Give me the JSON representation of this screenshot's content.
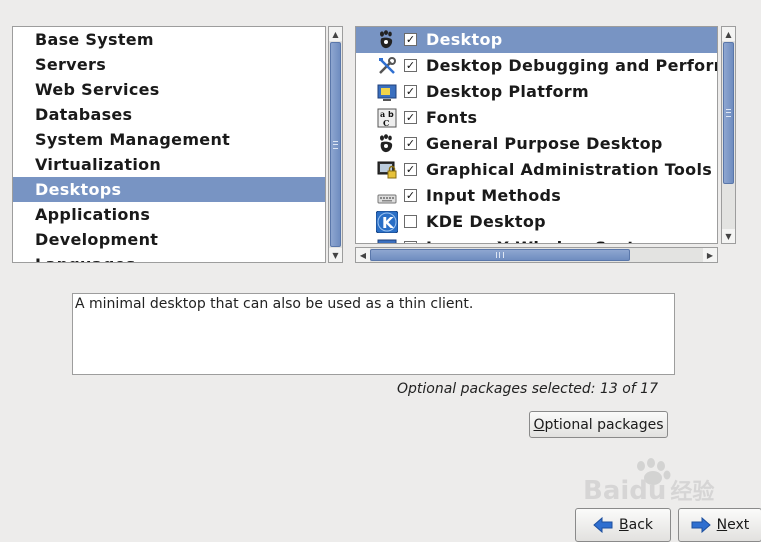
{
  "categories": [
    {
      "label": "Base System",
      "selected": false
    },
    {
      "label": "Servers",
      "selected": false
    },
    {
      "label": "Web Services",
      "selected": false
    },
    {
      "label": "Databases",
      "selected": false
    },
    {
      "label": "System Management",
      "selected": false
    },
    {
      "label": "Virtualization",
      "selected": false
    },
    {
      "label": "Desktops",
      "selected": true
    },
    {
      "label": "Applications",
      "selected": false
    },
    {
      "label": "Development",
      "selected": false
    },
    {
      "label": "Languages",
      "selected": false
    }
  ],
  "packages": [
    {
      "label": "Desktop",
      "checked": true,
      "selected": true,
      "icon": "gnome-foot-icon"
    },
    {
      "label": "Desktop Debugging and Perform",
      "checked": true,
      "selected": false,
      "icon": "tools-icon"
    },
    {
      "label": "Desktop Platform",
      "checked": true,
      "selected": false,
      "icon": "desktop-platform-icon"
    },
    {
      "label": "Fonts",
      "checked": true,
      "selected": false,
      "icon": "fonts-icon"
    },
    {
      "label": "General Purpose Desktop",
      "checked": true,
      "selected": false,
      "icon": "gnome-foot-icon"
    },
    {
      "label": "Graphical Administration Tools",
      "checked": true,
      "selected": false,
      "icon": "monitor-lock-icon"
    },
    {
      "label": "Input Methods",
      "checked": true,
      "selected": false,
      "icon": "keyboard-icon"
    },
    {
      "label": "KDE Desktop",
      "checked": false,
      "selected": false,
      "icon": "kde-icon"
    },
    {
      "label": "Legacy X Window System",
      "checked": false,
      "selected": false,
      "icon": "monitor-icon"
    }
  ],
  "description": "A minimal desktop that can also be used as a thin client.",
  "optional_status": "Optional packages selected: 13 of 17",
  "buttons": {
    "optional_packages": {
      "mnemonic": "O",
      "rest": "ptional packages"
    },
    "back": {
      "mnemonic": "B",
      "rest": "ack"
    },
    "next": {
      "mnemonic": "N",
      "rest": "ext"
    }
  },
  "watermark": {
    "brand": "Baidu",
    "suffix": "经验"
  },
  "colors": {
    "selection": "#7894c3",
    "accent_blue": "#2f6fd0",
    "panel_border": "#9d9d9d"
  }
}
